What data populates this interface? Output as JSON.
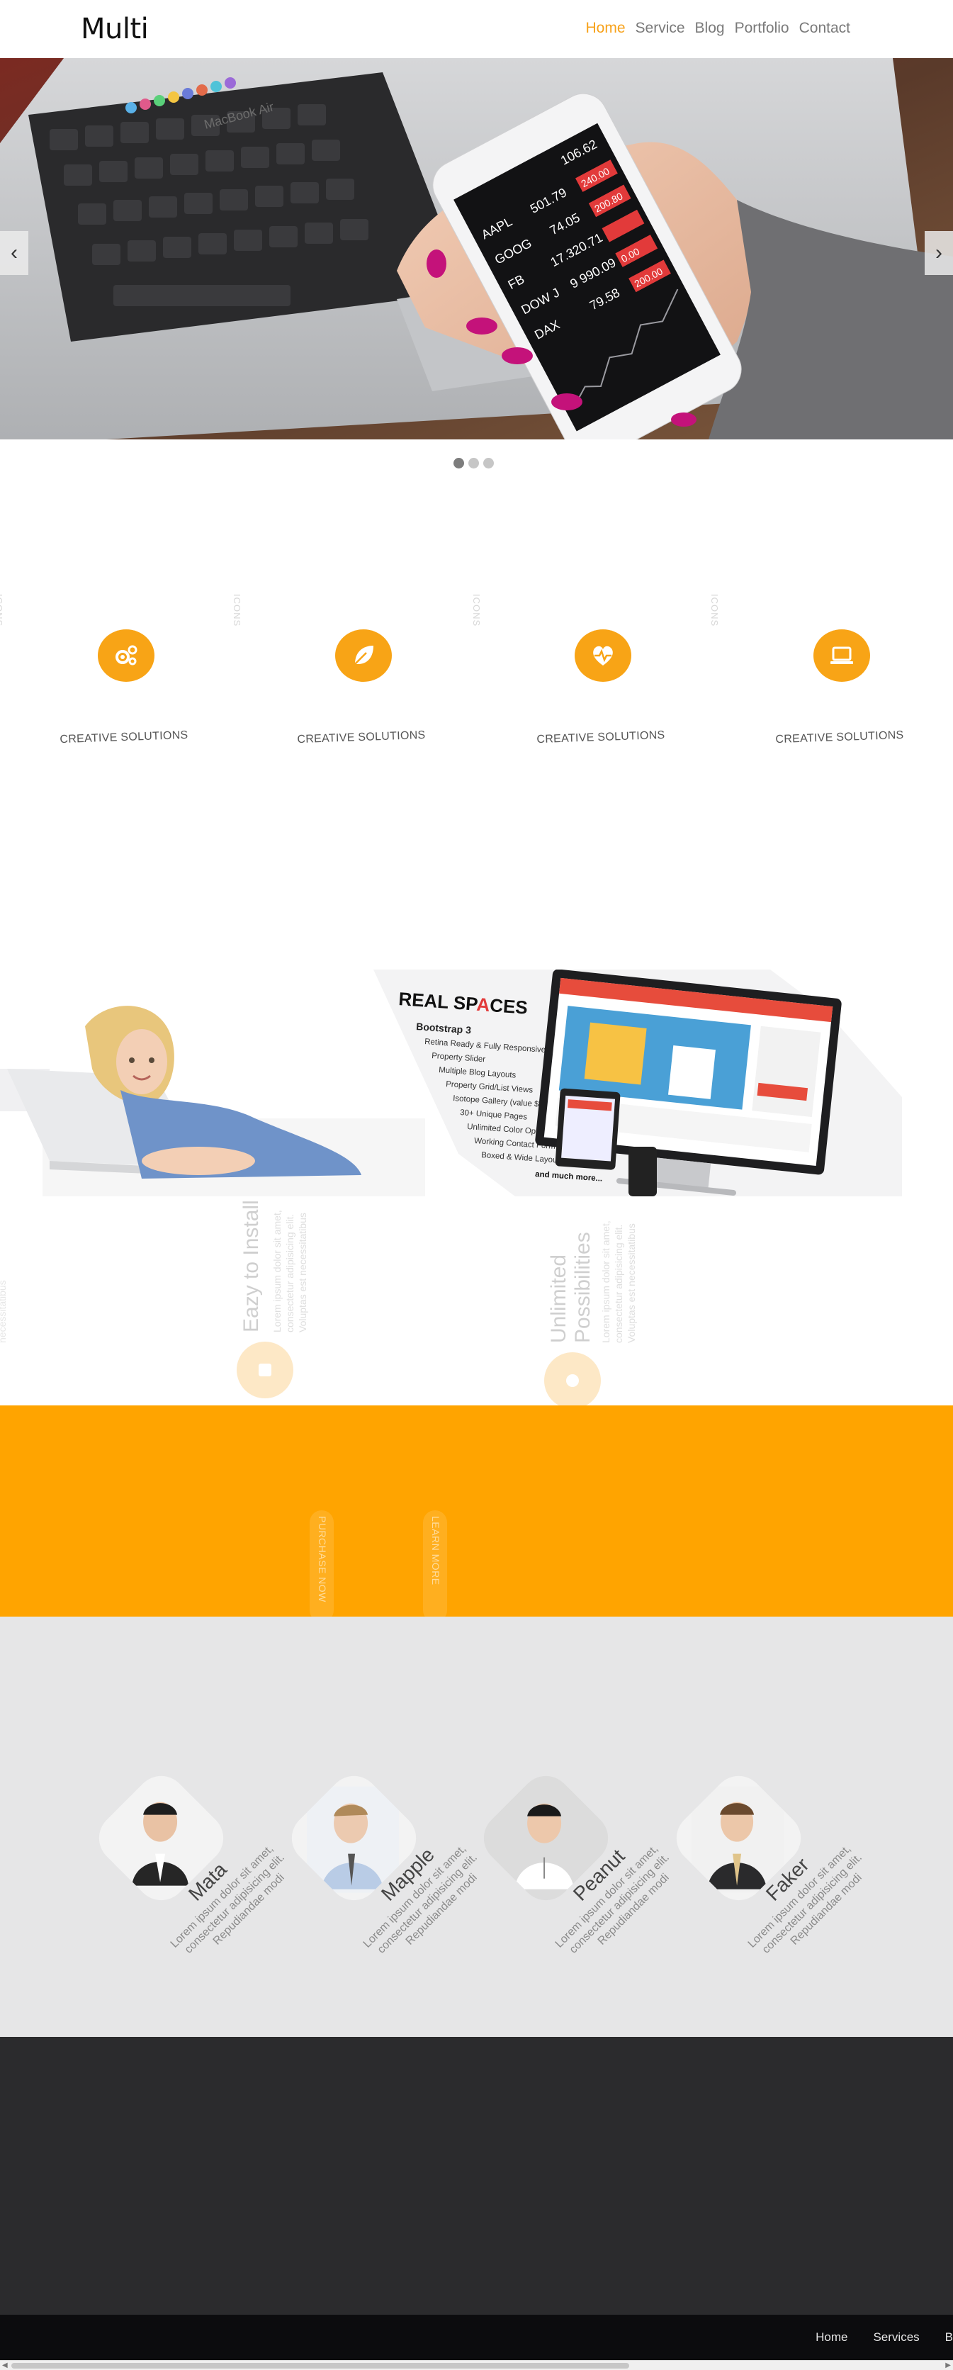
{
  "header": {
    "logo": "Multi",
    "nav": [
      {
        "label": "Home",
        "active": true
      },
      {
        "label": "Service",
        "active": false
      },
      {
        "label": "Blog",
        "active": false
      },
      {
        "label": "Portfolio",
        "active": false
      },
      {
        "label": "Contact",
        "active": false
      }
    ]
  },
  "hero": {
    "prev_label": "‹",
    "next_label": "›",
    "slide_count": 3,
    "active_slide": 1,
    "laptop_brand": "MacBook Air",
    "stock_rows": [
      {
        "ticker": "AAPL",
        "value": "501.79",
        "change": "240.00"
      },
      {
        "ticker": "GOOG",
        "value": "74.05",
        "change": "200.80"
      },
      {
        "ticker": "FB",
        "value": "17.320.71",
        "change": ""
      },
      {
        "ticker": "DOW J",
        "value": "9 990.09",
        "change": "0.00"
      },
      {
        "ticker": "DAX",
        "value": "79.58",
        "change": "200.00"
      }
    ],
    "stock_top": "106.62"
  },
  "features": {
    "items": [
      {
        "label": "CREATIVE SOLUTIONS",
        "icon": "gears-icon"
      },
      {
        "label": "CREATIVE SOLUTIONS",
        "icon": "leaf-icon"
      },
      {
        "label": "CREATIVE SOLUTIONS",
        "icon": "heart-pulse-icon"
      },
      {
        "label": "CREATIVE SOLUTIONS",
        "icon": "laptop-icon"
      }
    ],
    "ghost_label": "ICONS"
  },
  "products": {
    "left": {
      "title": "Eazy to Install",
      "body_lines": [
        "Lorem ipsum dolor sit amet,",
        "consectetur adipisicing elit.",
        "Voluptas est necessitatibus"
      ]
    },
    "right": {
      "title_lines": [
        "Unlimited",
        "Possibilities"
      ],
      "body_lines": [
        "Lorem ipsum dolor sit amet,",
        "consectetur adipisicing elit.",
        "Voluptas est necessitatibus"
      ]
    },
    "edge_text": "necessitatibus",
    "banner": {
      "title_a": "REAL SP",
      "title_b": "A",
      "title_c": "CES",
      "subtitle": "Bootstrap 3",
      "features": [
        "Retina Ready & Fully Responsive",
        "Property Slider",
        "Multiple Blog Layouts",
        "Property Grid/List Views",
        "Isotope Gallery (value $25)",
        "30+ Unique Pages",
        "Unlimited Color Options",
        "Working Contact Form",
        "Boxed & Wide Layouts"
      ],
      "more": "and much more..."
    }
  },
  "cta": {
    "buttons": [
      {
        "label": "PURCHASE NOW"
      },
      {
        "label": "LEARN MORE"
      }
    ]
  },
  "team": {
    "members": [
      {
        "name": "Mata",
        "lines": [
          "Lorem ipsum dolor sit amet,",
          "consectetur adipisicing elit.",
          "Repudiandae modi"
        ]
      },
      {
        "name": "Mapple",
        "lines": [
          "Lorem ipsum dolor sit amet,",
          "consectetur adipisicing elit.",
          "Repudiandae modi"
        ]
      },
      {
        "name": "Peanut",
        "lines": [
          "Lorem ipsum dolor sit amet,",
          "consectetur adipisicing elit.",
          "Repudiandae modi"
        ]
      },
      {
        "name": "Faker",
        "lines": [
          "Lorem ipsum dolor sit amet,",
          "consectetur adipisicing elit.",
          "Repudiandae modi"
        ]
      }
    ]
  },
  "footer": {
    "nav": [
      {
        "label": "Home"
      },
      {
        "label": "Services"
      },
      {
        "label": "B"
      }
    ]
  },
  "colors": {
    "accent": "#f8a416",
    "orange_band": "#ffa400",
    "team_bg": "#e6e6e7",
    "dark_bg": "#2b2b2d",
    "footer_bg": "#0c0c0e"
  }
}
